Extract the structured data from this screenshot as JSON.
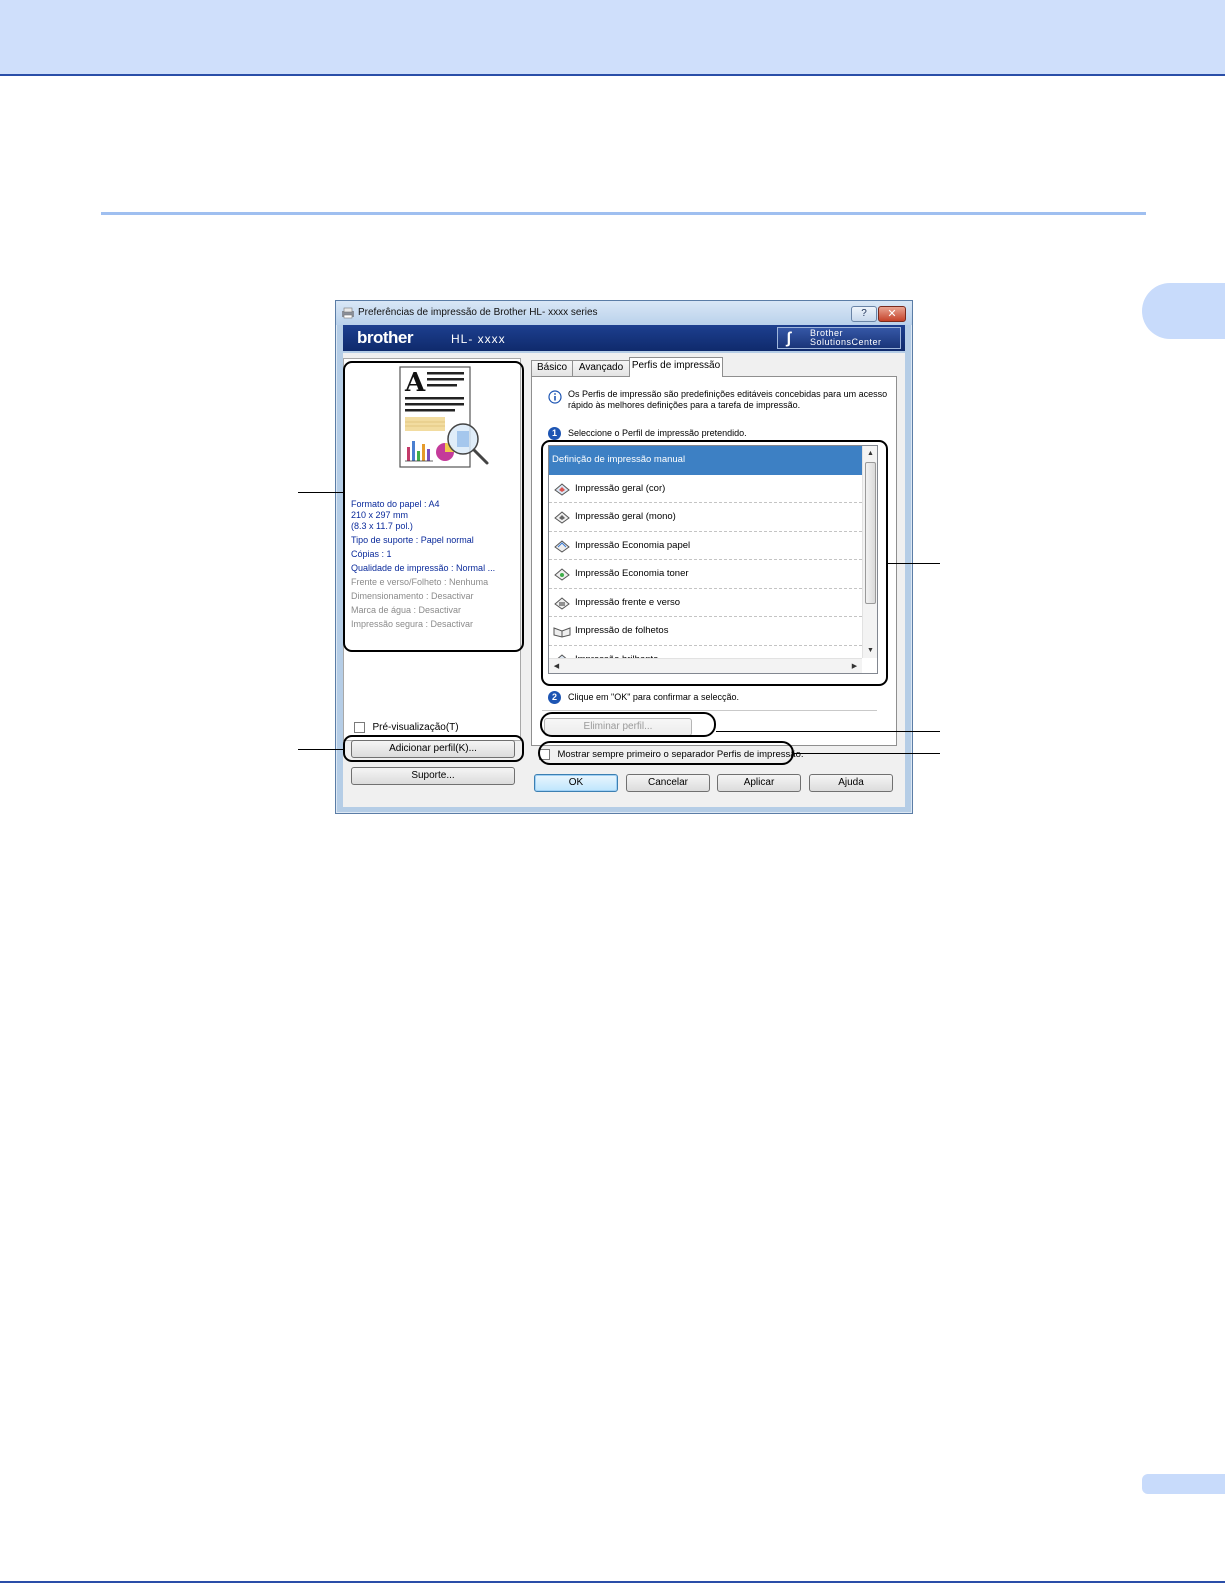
{
  "dialog": {
    "title": "Preferências de impressão de Brother HL- xxxx  series",
    "help_button": "?",
    "close_button": "✕",
    "brand": "brother",
    "model": "HL- xxxx",
    "solutions_center": "Brother\nSolutionsCenter"
  },
  "summary": {
    "lines": [
      "Formato do papel : A4",
      "210 x 297 mm",
      "(8.3 x 11.7 pol.)",
      "Tipo de suporte : Papel normal",
      "Cópias : 1",
      "Qualidade de impressão : Normal ...",
      "Frente e verso/Folheto : Nenhuma",
      "Dimensionamento : Desactivar",
      "Marca de água : Desactivar",
      "Impressão segura : Desactivar"
    ]
  },
  "left": {
    "preview_checkbox_label": "Pré-visualização(T)",
    "add_profile_button": "Adicionar perfil(K)...",
    "support_button": "Suporte..."
  },
  "tabs": [
    "Básico",
    "Avançado",
    "Perfis de impressão"
  ],
  "profiles_tab": {
    "info_text": "Os Perfis de impressão são predefinições editáveis concebidas para um acesso rápido às melhores definições para a tarefa de impressão.",
    "step1_number": "1",
    "step1_text": "Seleccione o Perfil de impressão pretendido.",
    "list_items": [
      "Definição de impressão manual",
      "Impressão geral (cor)",
      "Impressão geral (mono)",
      "Impressão Economia papel",
      "Impressão Economia toner",
      "Impressão frente e verso",
      "Impressão de folhetos",
      "Impressão brilhante"
    ],
    "selected_index": 0,
    "step2_number": "2",
    "step2_text": "Clique em \"OK\" para confirmar a selecção.",
    "delete_profile_button": "Eliminar perfil...",
    "always_first_checkbox_label": "Mostrar sempre primeiro o separador Perfis de impressão."
  },
  "buttons": {
    "ok": "OK",
    "cancel": "Cancelar",
    "apply": "Aplicar",
    "help": "Ajuda"
  },
  "colors": {
    "page_header_bg": "#cfdffb",
    "brand_bar": "#1d3f8f",
    "selection": "#3d80c4",
    "active_summary_text": "#0a2a9b"
  }
}
